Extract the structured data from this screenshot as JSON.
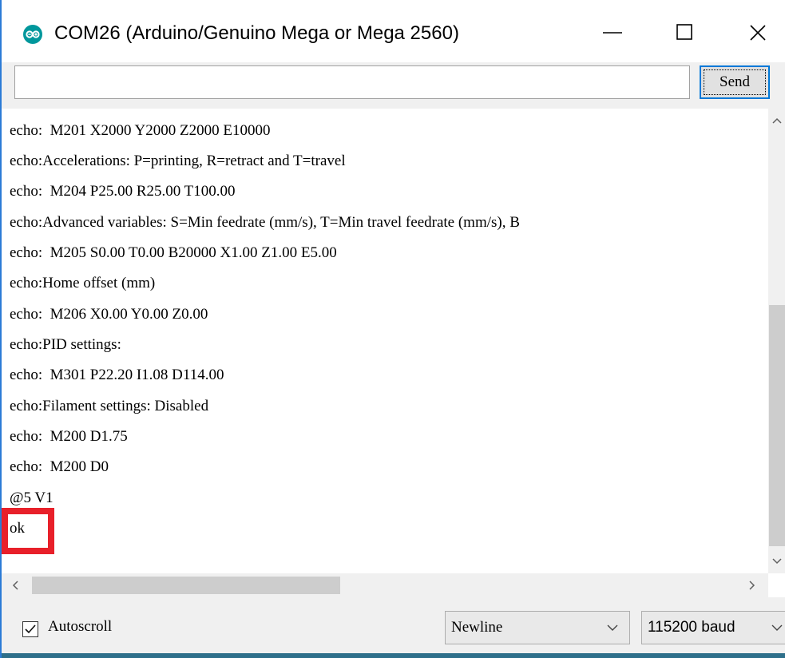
{
  "window": {
    "title": "COM26 (Arduino/Genuino Mega or Mega 2560)",
    "icon": "arduino-logo-icon",
    "controls": [
      "minimize-icon",
      "maximize-icon",
      "close-icon"
    ]
  },
  "input": {
    "value": "",
    "send_label": "Send"
  },
  "output": {
    "cut_text": ". . . , .",
    "lines": [
      "echo:  M201 X2000 Y2000 Z2000 E10000",
      "echo:Accelerations: P=printing, R=retract and T=travel",
      "echo:  M204 P25.00 R25.00 T100.00",
      "echo:Advanced variables: S=Min feedrate (mm/s), T=Min travel feedrate (mm/s), B",
      "echo:  M205 S0.00 T0.00 B20000 X1.00 Z1.00 E5.00",
      "echo:Home offset (mm)",
      "echo:  M206 X0.00 Y0.00 Z0.00",
      "echo:PID settings:",
      "echo:  M301 P22.20 I1.08 D114.00",
      "echo:Filament settings: Disabled",
      "echo:  M200 D1.75",
      "echo:  M200 D0",
      "@5 V1",
      "ok"
    ],
    "highlight_color": "#e8202a"
  },
  "bottom": {
    "autoscroll_label": "Autoscroll",
    "autoscroll_checked": true,
    "line_ending": "Newline",
    "baud_rate": "115200 baud"
  },
  "colors": {
    "accent": "#0078d7",
    "arduino_teal": "#00979c"
  }
}
